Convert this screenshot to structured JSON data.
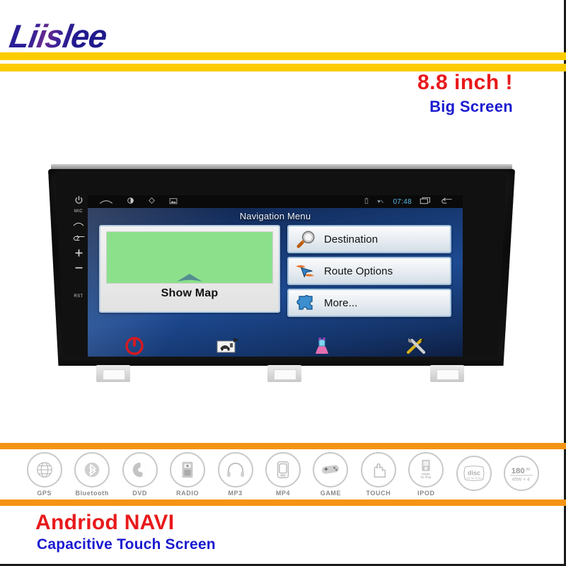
{
  "header": {
    "brand": "Liislee",
    "tagline_main": "8.8 inch !",
    "tagline_sub": "Big Screen",
    "stripe_color": "#fdcc00"
  },
  "device": {
    "bezel_buttons": [
      {
        "name": "power",
        "label": ""
      },
      {
        "name": "mic-label",
        "label": "MIC"
      },
      {
        "name": "home",
        "label": ""
      },
      {
        "name": "back",
        "label": ""
      },
      {
        "name": "volume-up",
        "label": "+"
      },
      {
        "name": "volume-down",
        "label": "−"
      },
      {
        "name": "reset",
        "label": "RST"
      }
    ],
    "statusbar": {
      "clock": "07:48",
      "left_icons": [
        "home-icon",
        "brightness-icon",
        "diamond-icon",
        "gallery-icon"
      ],
      "right_icons": [
        "battery-icon",
        "wifi-icon",
        "recents-icon",
        "back-icon"
      ],
      "clock_color": "#5bb9e8"
    },
    "screen": {
      "title": "Navigation Menu",
      "show_map_label": "Show Map",
      "menu_items": [
        {
          "label": "Destination",
          "icon": "magnifier-icon"
        },
        {
          "label": "Route Options",
          "icon": "route-arrow-icon"
        },
        {
          "label": "More...",
          "icon": "puzzle-piece-icon"
        }
      ],
      "taskbar_icons": [
        "power-icon",
        "speed-camera-icon",
        "gps-figure-icon",
        "tools-icon"
      ],
      "background_color": "#1d4a92",
      "map_color": "#8ce08c"
    }
  },
  "features": [
    {
      "label": "GPS",
      "icon": "globe-icon"
    },
    {
      "label": "Bluetooth",
      "icon": "bluetooth-icon"
    },
    {
      "label": "DVD",
      "icon": "dvd-disc-icon"
    },
    {
      "label": "RADIO",
      "icon": "radio-icon"
    },
    {
      "label": "MP3",
      "icon": "headphones-icon"
    },
    {
      "label": "MP4",
      "icon": "media-player-icon"
    },
    {
      "label": "GAME",
      "icon": "gamepad-icon"
    },
    {
      "label": "TOUCH",
      "icon": "hand-touch-icon"
    },
    {
      "label": "IPOD",
      "icon": "made-for-ipod-icon"
    },
    {
      "label": "",
      "icon": "compact-disc-digital-audio-icon"
    },
    {
      "label": "",
      "icon": "power-180w-icon"
    }
  ],
  "badges": {
    "disc_text": "disc",
    "disc_sub": "DIGITAL AUDIO",
    "watt_main": "180",
    "watt_unit": "W",
    "watt_sub": "45W × 4"
  },
  "footer": {
    "title": "Andriod NAVI",
    "subtitle": "Capacitive Touch Screen",
    "band_color": "#f59413"
  }
}
